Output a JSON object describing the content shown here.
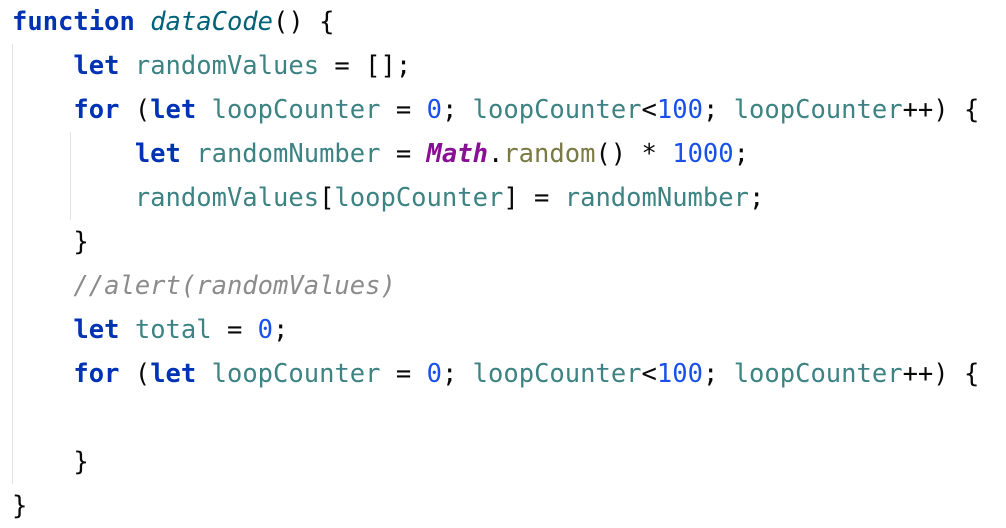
{
  "code": {
    "l1": {
      "kw": "function",
      "name": "dataCode",
      "rest": "() {"
    },
    "l2": {
      "kw": "let",
      "var": "randomValues",
      "rest": " = [];"
    },
    "l3": {
      "kw_for": "for",
      "open": " (",
      "kw_let": "let",
      "var1": "loopCounter",
      "eq": " = ",
      "num1": "0",
      "semi1": "; ",
      "var2": "loopCounter",
      "lt": "<",
      "num2": "100",
      "semi2": "; ",
      "var3": "loopCounter",
      "close": "++) {"
    },
    "l4": {
      "kw": "let",
      "var": "randomNumber",
      "eq": " = ",
      "cls": "Math",
      "dot": ".",
      "meth": "random",
      "mid": "() * ",
      "num": "1000",
      "end": ";"
    },
    "l5": {
      "var1": "randomValues",
      "br1": "[",
      "var2": "loopCounter",
      "mid": "] = ",
      "var3": "randomNumber",
      "end": ";"
    },
    "l6": {
      "text": "}"
    },
    "l7": {
      "text": "//alert(randomValues)"
    },
    "l8": {
      "kw": "let",
      "var": "total",
      "eq": " = ",
      "num": "0",
      "end": ";"
    },
    "l9": {
      "kw_for": "for",
      "open": " (",
      "kw_let": "let",
      "var1": "loopCounter",
      "eq": " = ",
      "num1": "0",
      "semi1": "; ",
      "var2": "loopCounter",
      "lt": "<",
      "num2": "100",
      "semi2": "; ",
      "var3": "loopCounter",
      "close": "++) {"
    },
    "l11": {
      "text": "}"
    },
    "l12": {
      "text": "}"
    }
  }
}
